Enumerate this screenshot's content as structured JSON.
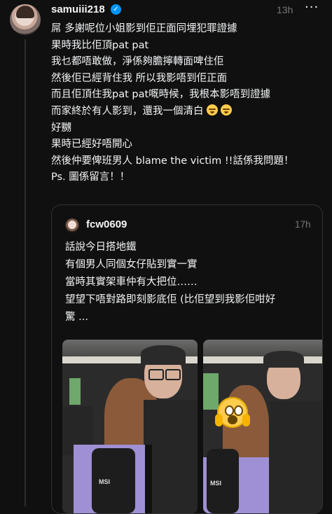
{
  "post": {
    "username": "samuiii218",
    "verified_icon": "verified-badge-icon",
    "time": "13h",
    "more_label": "···",
    "lines": [
      "屌 多謝呢位小姐影到佢正面同埋犯罪證據",
      "果時我比佢頂pat pat",
      "我乜都唔敢做，淨係夠膽擰轉面啤住佢",
      "然後佢已經背住我 所以我影唔到佢正面",
      "而且佢頂住我pat pat嘅時候，我根本影唔到證據",
      "而家終於有人影到，還我一個清白",
      "好嬲",
      "果時已經好唔開心",
      "然後仲要俾班男人 blame the victim !!話係我問題！",
      "Ps. 圖係留言！！"
    ],
    "emojis": [
      "face-with-steam-icon",
      "face-with-steam-icon"
    ]
  },
  "quote": {
    "username": "fcw0609",
    "time": "17h",
    "lines": [
      "話說今日搭地鐵",
      "有個男人同個女仔貼到實一實",
      "當時其實架車仲有大把位……",
      "望望下唔對路即刻影底佢 (比佢望到我影佢咁好",
      "驚 ..."
    ],
    "photo1_label": "MSI",
    "photo2_label": "MSI",
    "photo2_emoji": "face-screaming-in-fear-icon"
  },
  "colors": {
    "background": "#101010",
    "text": "#f3f5f7",
    "muted": "#777777",
    "verified": "#0095f6",
    "border": "#333333"
  }
}
